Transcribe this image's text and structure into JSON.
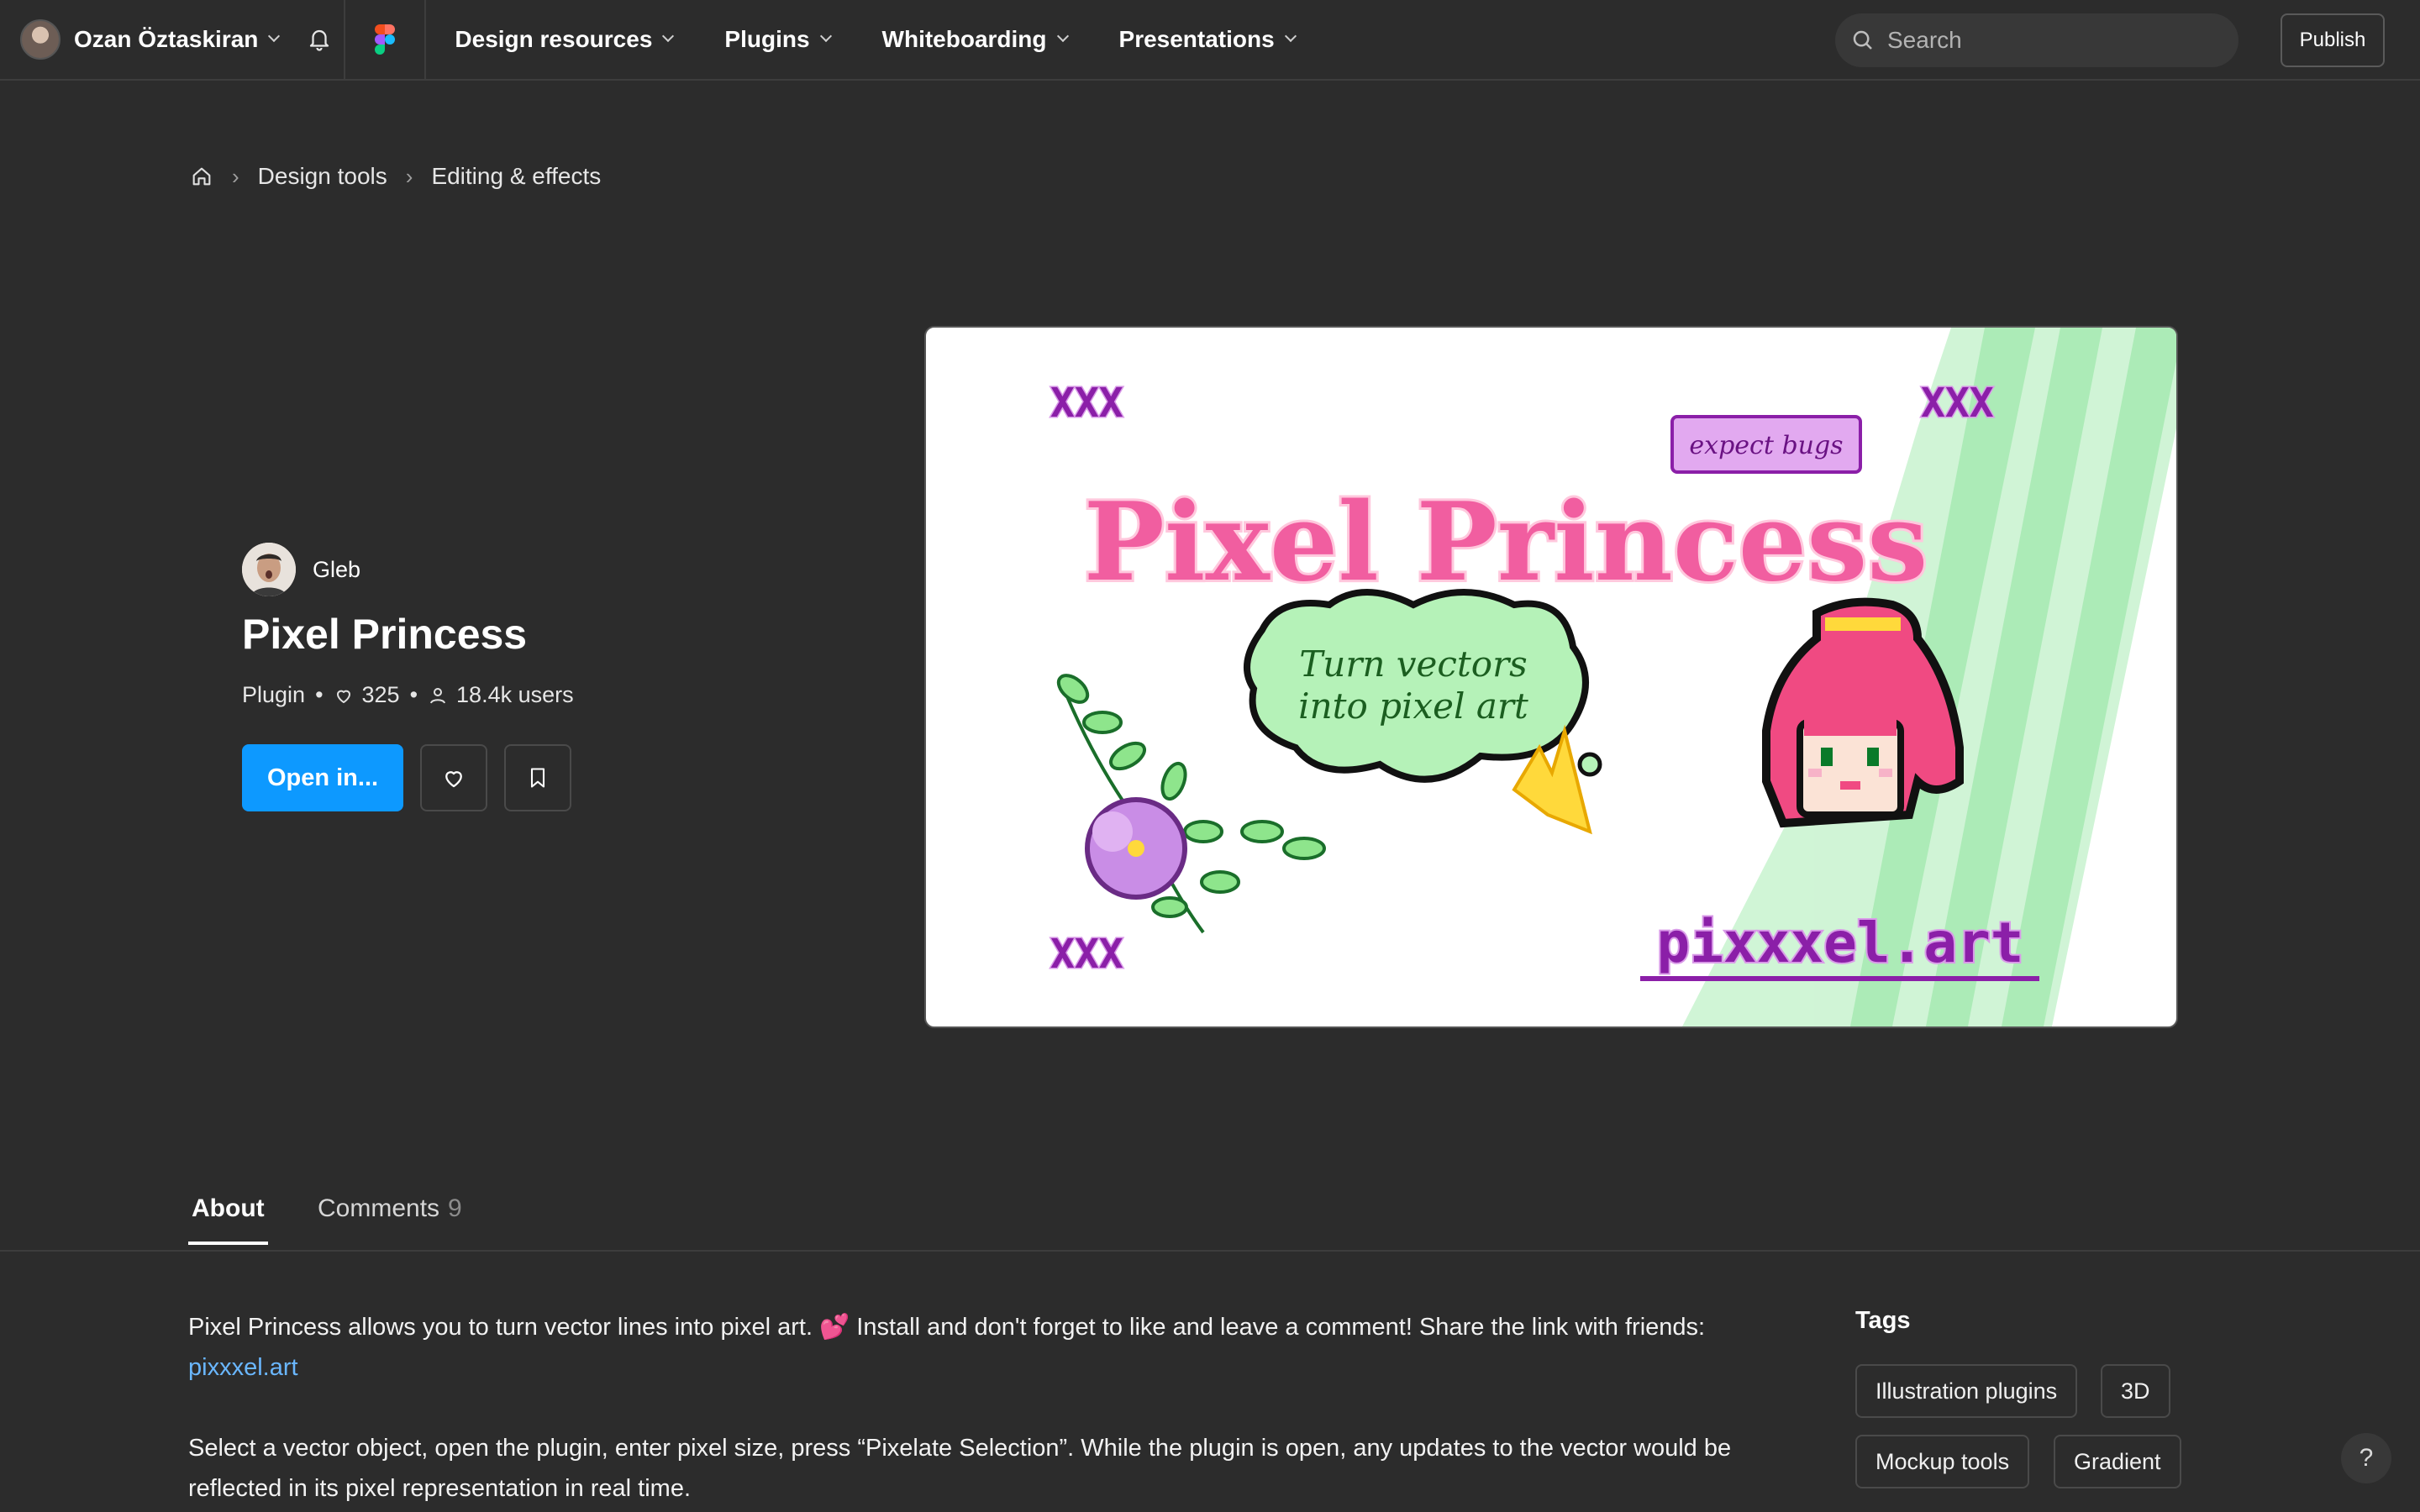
{
  "topbar": {
    "user_name": "Ozan Öztaskiran",
    "nav": [
      {
        "label": "Design resources"
      },
      {
        "label": "Plugins"
      },
      {
        "label": "Whiteboarding"
      },
      {
        "label": "Presentations"
      }
    ],
    "search_placeholder": "Search",
    "publish_label": "Publish"
  },
  "breadcrumb": {
    "items": [
      "Design tools",
      "Editing & effects"
    ]
  },
  "plugin": {
    "author": "Gleb",
    "title": "Pixel Princess",
    "type": "Plugin",
    "likes": "325",
    "users": "18.4k users",
    "open_label": "Open in..."
  },
  "hero": {
    "corner_mark": "XXX",
    "badge": "expect bugs",
    "title_art": "Pixel Princess",
    "speech_line1": "Turn vectors",
    "speech_line2": "into pixel art",
    "site": "pixxxel.art"
  },
  "tabs": {
    "about": "About",
    "comments": "Comments",
    "comments_count": "9"
  },
  "about": {
    "para1": "Pixel Princess allows you to turn vector lines into pixel art. 💕 Install and don't forget to like and leave a comment! Share the link with friends:",
    "link": "pixxxel.art",
    "para2": "Select a vector object, open the plugin, enter pixel size, press “Pixelate Selection”. While the plugin is open, any updates to the vector would be reflected in its pixel representation in real time."
  },
  "tags": {
    "title": "Tags",
    "items": [
      "Illustration plugins",
      "3D",
      "Mockup tools",
      "Gradient"
    ]
  },
  "help_label": "?",
  "colors": {
    "accent": "#0d99ff",
    "background": "#2c2c2c",
    "link": "#6ab7ff"
  }
}
